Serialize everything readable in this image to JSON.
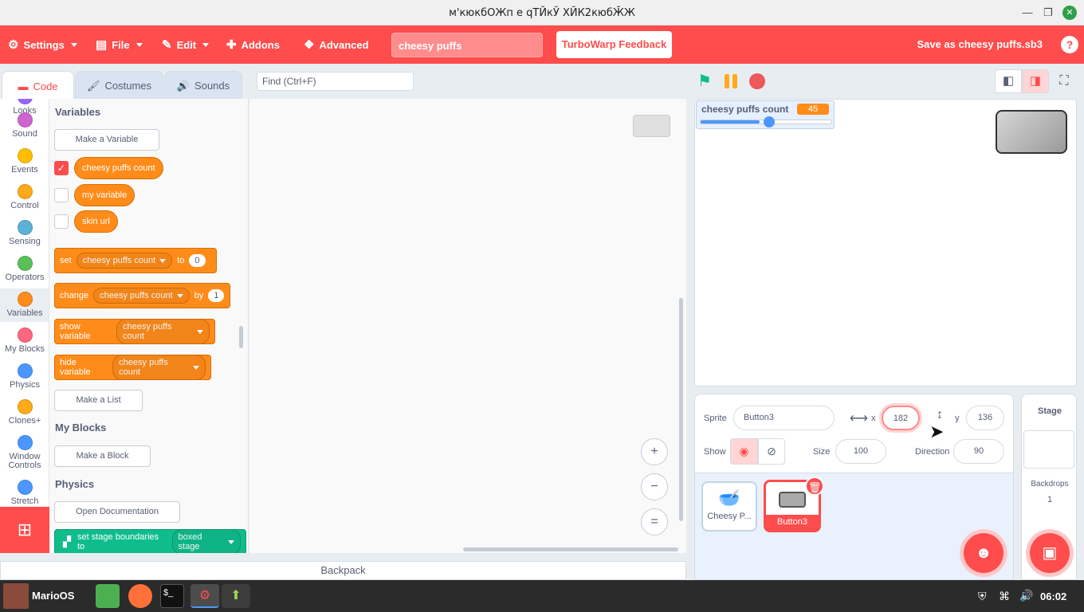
{
  "window": {
    "title": "м'кюкбОЖп е  qТЙкЎ ХЙК2кюбӁЖ"
  },
  "menu": {
    "settings": "Settings",
    "file": "File",
    "edit": "Edit",
    "addons": "Addons",
    "advanced": "Advanced",
    "project_title": "cheesy puffs",
    "feedback": "TurboWarp Feedback",
    "save_as": "Save as cheesy puffs.sb3",
    "help": "?"
  },
  "tabs": {
    "code": "Code",
    "costumes": "Costumes",
    "sounds": "Sounds"
  },
  "find": {
    "placeholder": "Find (Ctrl+F)"
  },
  "categories": [
    {
      "label": "Looks",
      "color": "#9966ff"
    },
    {
      "label": "Sound",
      "color": "#cf63cf"
    },
    {
      "label": "Events",
      "color": "#ffbf00"
    },
    {
      "label": "Control",
      "color": "#ffab19"
    },
    {
      "label": "Sensing",
      "color": "#5cb1d6"
    },
    {
      "label": "Operators",
      "color": "#59c059"
    },
    {
      "label": "Variables",
      "color": "#ff8c1a"
    },
    {
      "label": "My Blocks",
      "color": "#ff6680"
    },
    {
      "label": "Physics",
      "color": "#4c97ff"
    },
    {
      "label": "Clones+",
      "color": "#ffab19"
    },
    {
      "label": "Window Controls",
      "color": "#4c97ff"
    },
    {
      "label": "Stretch",
      "color": "#4c97ff"
    }
  ],
  "palette": {
    "variables_heading": "Variables",
    "make_variable": "Make a Variable",
    "vars": [
      {
        "name": "cheesy puffs count",
        "checked": true
      },
      {
        "name": "my variable",
        "checked": false
      },
      {
        "name": "skin url",
        "checked": false
      }
    ],
    "set_block": {
      "verb": "set",
      "var": "cheesy puffs count",
      "to": "to",
      "value": "0"
    },
    "change_block": {
      "verb": "change",
      "var": "cheesy puffs count",
      "by": "by",
      "value": "1"
    },
    "show_block": {
      "verb": "show variable",
      "var": "cheesy puffs count"
    },
    "hide_block": {
      "verb": "hide variable",
      "var": "cheesy puffs count"
    },
    "make_list": "Make a List",
    "myblocks_heading": "My Blocks",
    "make_block": "Make a Block",
    "physics_heading": "Physics",
    "open_docs": "Open Documentation",
    "physics_block": {
      "verb": "set stage boundaries to",
      "value": "boxed stage"
    }
  },
  "zoom": {
    "in": "+",
    "out": "−",
    "reset": "="
  },
  "backpack": "Backpack",
  "monitor": {
    "label": "cheesy puffs count",
    "value": "45",
    "slider_fraction": 0.45
  },
  "sprite": {
    "label": "Sprite",
    "name": "Button3",
    "x_label": "x",
    "x": "182",
    "y_label": "y",
    "y": "136",
    "show_label": "Show",
    "size_label": "Size",
    "size": "100",
    "direction_label": "Direction",
    "direction": "90"
  },
  "sprites": [
    {
      "name": "Cheesy P...",
      "selected": false
    },
    {
      "name": "Button3",
      "selected": true
    }
  ],
  "stage_panel": {
    "title": "Stage",
    "backdrops_label": "Backdrops",
    "backdrops_count": "1"
  },
  "taskbar": {
    "start_label": "MarioOS",
    "clock": "06:02"
  },
  "colors": {
    "accent": "#ff4c4c",
    "variable": "#ff8c1a",
    "physics": "#0fbd8c"
  }
}
